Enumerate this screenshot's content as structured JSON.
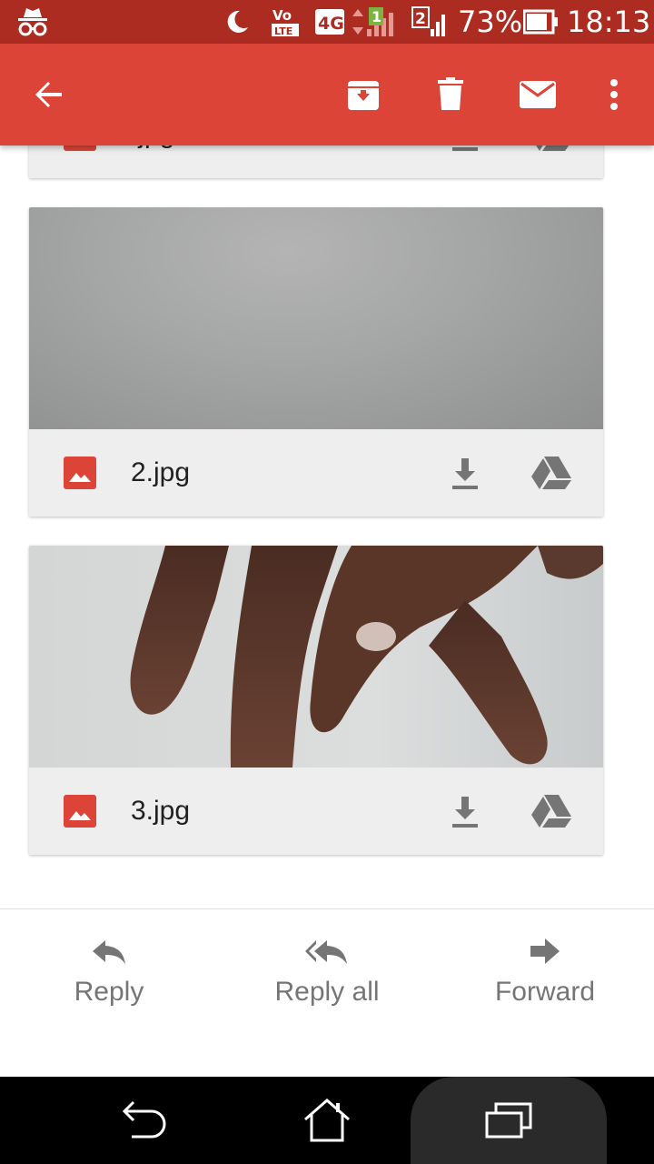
{
  "status_bar": {
    "battery": "73%",
    "time": "18:13",
    "network": "4G",
    "volte": "VoLTE",
    "sim1": "1",
    "sim2": "2"
  },
  "toolbar": {
    "back_icon": "arrow-back-icon",
    "archive_icon": "archive-icon",
    "delete_icon": "delete-icon",
    "mail_icon": "mark-unread-icon",
    "more_icon": "more-vert-icon"
  },
  "attachments": [
    {
      "name": ".jpg"
    },
    {
      "name": "2.jpg"
    },
    {
      "name": "3.jpg"
    }
  ],
  "actions": {
    "reply": "Reply",
    "reply_all": "Reply all",
    "forward": "Forward"
  },
  "colors": {
    "appbar": "#db4437",
    "statusbar": "#ad2c22",
    "icon_red": "#db4437",
    "icon_grey": "#757575"
  }
}
